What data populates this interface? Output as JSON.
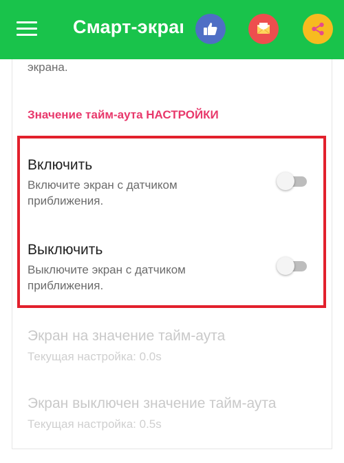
{
  "app_bar": {
    "title": "Смарт-экран",
    "color": "#19c34b",
    "icons": {
      "menu": "hamburger-menu-icon",
      "like": "thumbs-up-icon",
      "mail": "envelope-icon",
      "share": "share-icon"
    }
  },
  "preferences": {
    "previous_summary_tail": "экрана.",
    "section_header": "Значение тайм-аута НАСТРОЙКИ",
    "items": [
      {
        "title": "Включить",
        "summary": "Включите экран с датчиком приближения.",
        "enabled": true,
        "checked": false
      },
      {
        "title": "Выключить",
        "summary": "Выключите экран с датчиком приближения.",
        "enabled": true,
        "checked": false
      },
      {
        "title": "Экран на значение тайм-аута",
        "summary": "Текущая настройка: 0.0s",
        "enabled": false
      },
      {
        "title": "Экран выключен значение тайм-аута",
        "summary": "Текущая настройка: 0.5s",
        "enabled": false
      }
    ]
  },
  "colors": {
    "accent_header": "#e8386b",
    "highlight_border": "#e2202c",
    "like_button": "#4f6fc5",
    "mail_button": "#ee4e4e",
    "share_button": "#f7bb1f"
  }
}
